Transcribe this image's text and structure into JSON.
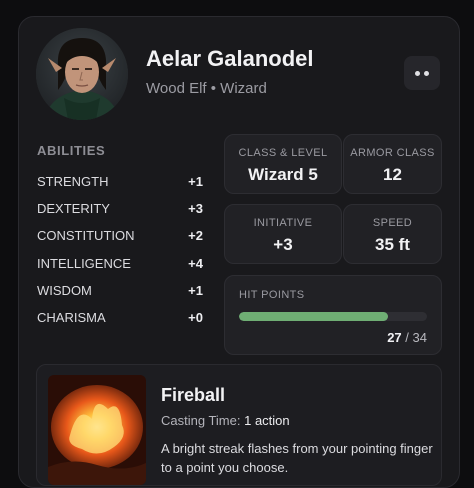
{
  "character": {
    "name": "Aelar Galanodel",
    "subtitle": "Wood Elf • Wizard"
  },
  "abilities": {
    "title": "ABILITIES",
    "items": [
      {
        "label": "STRENGTH",
        "mod": "+1"
      },
      {
        "label": "DEXTERITY",
        "mod": "+3"
      },
      {
        "label": "CONSTITUTION",
        "mod": "+2"
      },
      {
        "label": "INTELLIGENCE",
        "mod": "+4"
      },
      {
        "label": "WISDOM",
        "mod": "+1"
      },
      {
        "label": "CHARISMA",
        "mod": "+0"
      }
    ]
  },
  "stats": {
    "class_level": {
      "label": "CLASS & LEVEL",
      "value": "Wizard 5"
    },
    "armor_class": {
      "label": "ARMOR CLASS",
      "value": "12"
    },
    "initiative": {
      "label": "INITIATIVE",
      "value": "+3"
    },
    "speed": {
      "label": "SPEED",
      "value": "35 ft"
    }
  },
  "hit_points": {
    "label": "HIT POINTS",
    "current": "27",
    "separator": "/",
    "max": "34",
    "fraction": 0.794
  },
  "spell": {
    "name": "Fireball",
    "casting_time_label": "Casting Time:",
    "casting_time_value": "1 action",
    "description": "A bright streak flashes from your pointing finger to a point you choose."
  },
  "colors": {
    "hp_bar": "#6fae74",
    "card_bg": "#19191c"
  },
  "icons": {
    "menu": "more-dots-icon"
  }
}
